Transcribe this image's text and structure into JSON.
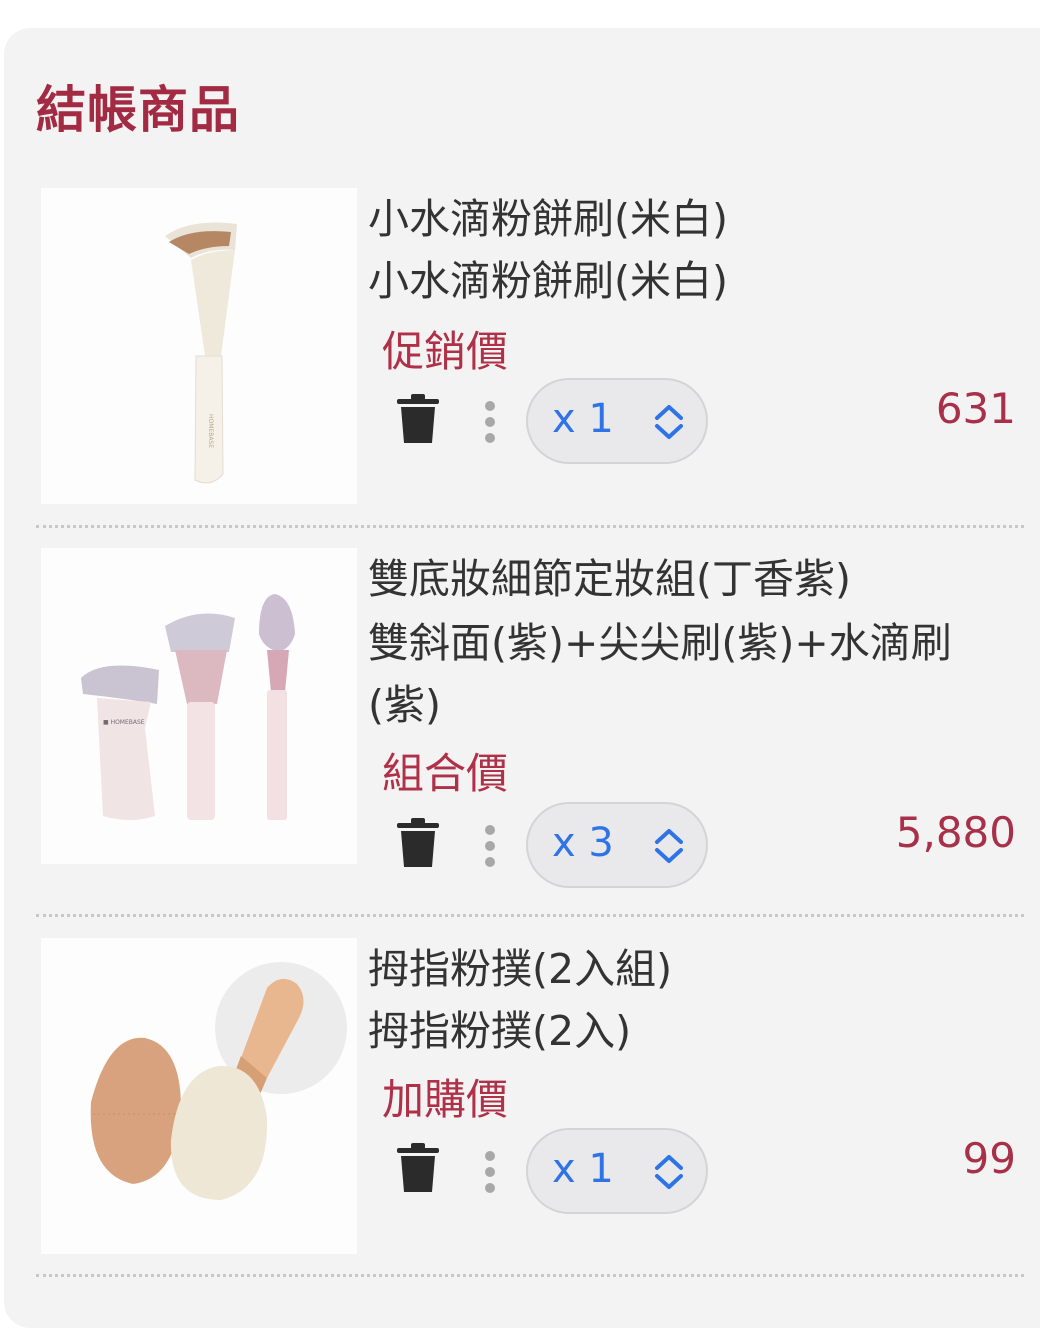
{
  "section_title": "結帳商品",
  "items": [
    {
      "name": "小水滴粉餅刷(米白)",
      "variant": "小水滴粉餅刷(米白)",
      "price_tag": "促銷價",
      "quantity_label": "x 1",
      "price": "631",
      "image_icon": "makeup-brush-cream-image"
    },
    {
      "name": "雙底妝細節定妝組(丁香紫)",
      "variant": "雙斜面(紫)+尖尖刷(紫)+水滴刷(紫)",
      "price_tag": "組合價",
      "quantity_label": "x 3",
      "price": "5,880",
      "image_icon": "brush-set-lilac-image"
    },
    {
      "name": "拇指粉撲(2入組)",
      "variant": "拇指粉撲(2入)",
      "price_tag": "加購價",
      "quantity_label": "x 1",
      "price": "99",
      "image_icon": "thumb-puff-image"
    }
  ],
  "icons": {
    "delete": "trash-icon",
    "more": "more-vertical-icon",
    "stepper": "chevron-up-down-icon"
  },
  "colors": {
    "accent": "#a32a43",
    "price": "#a83049",
    "stepper_text": "#2f74e6",
    "panel_bg": "#f3f3f3"
  }
}
